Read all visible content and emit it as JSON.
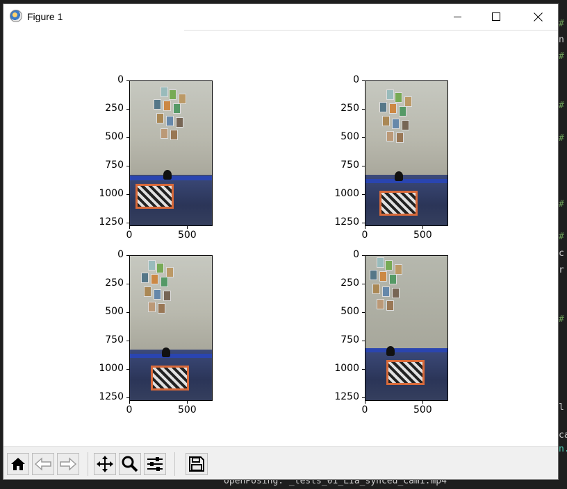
{
  "window": {
    "title": "Figure 1"
  },
  "background": {
    "bottom_text": "openPosing: _tests_01_LIa_synced_cam1.mp4",
    "editor_lines": [
      "#",
      "n",
      "#",
      "#",
      "#",
      "#",
      "#",
      "c",
      "r",
      "#",
      "l",
      "ca",
      "n."
    ]
  },
  "subplots": [
    {
      "yticks": [
        "0",
        "250",
        "500",
        "750",
        "1000",
        "1250"
      ],
      "xticks": [
        "0",
        "500"
      ]
    },
    {
      "yticks": [
        "0",
        "250",
        "500",
        "750",
        "1000",
        "1250"
      ],
      "xticks": [
        "0",
        "500"
      ]
    },
    {
      "yticks": [
        "0",
        "250",
        "500",
        "750",
        "1000",
        "1250"
      ],
      "xticks": [
        "0",
        "500"
      ]
    },
    {
      "yticks": [
        "0",
        "250",
        "500",
        "750",
        "1000",
        "1250"
      ],
      "xticks": [
        "0",
        "500"
      ]
    }
  ],
  "toolbar": {
    "buttons": [
      {
        "name": "home-button",
        "icon": "home-icon"
      },
      {
        "name": "back-button",
        "icon": "arrow-left-icon"
      },
      {
        "name": "forward-button",
        "icon": "arrow-right-icon"
      },
      {
        "name": "pan-button",
        "icon": "move-icon"
      },
      {
        "name": "zoom-button",
        "icon": "magnifier-icon"
      },
      {
        "name": "configure-subplots-button",
        "icon": "sliders-icon"
      },
      {
        "name": "save-button",
        "icon": "floppy-disk-icon"
      }
    ]
  }
}
